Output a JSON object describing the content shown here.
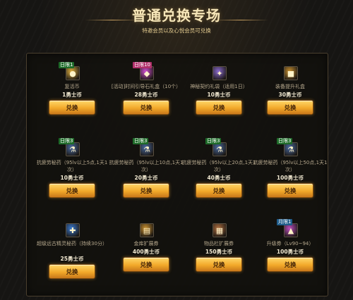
{
  "header": {
    "title": "普通兑换专场",
    "subtitle": "特邀会员以及心悦会员可兑换"
  },
  "items": [
    {
      "limit": "日限1",
      "limit_style": "day",
      "name": "复活币",
      "price": "1勇士币",
      "button": "兑换",
      "icon": "coin-icon",
      "icon_color": "#e0b040"
    },
    {
      "limit": "日限10",
      "limit_style": "pink",
      "name": "[活动]时间引导石礼盒（10个）",
      "price": "28勇士币",
      "button": "兑换",
      "icon": "gem-box-icon",
      "icon_color": "#d050d0"
    },
    {
      "limit": "",
      "limit_style": "",
      "name": "神秘契约礼袋（适用1日）",
      "price": "10勇士币",
      "button": "兑换",
      "icon": "bag-icon",
      "icon_color": "#8a6ad0"
    },
    {
      "limit": "",
      "limit_style": "",
      "name": "装备提升礼盒",
      "price": "30勇士币",
      "button": "兑换",
      "icon": "chest-icon",
      "icon_color": "#c89030"
    },
    {
      "limit": "日限3",
      "limit_style": "day",
      "name": "抗疲劳秘药（95lv以上5点,1天1次）",
      "price": "10勇士币",
      "button": "兑换",
      "icon": "potion-icon",
      "icon_color": "#4a6aa0"
    },
    {
      "limit": "日限3",
      "limit_style": "day",
      "name": "抗疲劳秘药（95lv以上10点,1天1次）",
      "price": "20勇士币",
      "button": "兑换",
      "icon": "potion-icon",
      "icon_color": "#4a6aa0"
    },
    {
      "limit": "日限3",
      "limit_style": "day",
      "name": "抗疲劳秘药（95lv以上20点,1天1次）",
      "price": "40勇士币",
      "button": "兑换",
      "icon": "potion-icon",
      "icon_color": "#4a6aa0"
    },
    {
      "limit": "日限3",
      "limit_style": "day",
      "name": "抗疲劳秘药（95lv以上50点,1天1次）",
      "price": "100勇士币",
      "button": "兑换",
      "icon": "potion-icon",
      "icon_color": "#4a6aa0"
    },
    {
      "limit": "",
      "limit_style": "",
      "name": "超级远古精灵秘药（持续30分）",
      "price": "25勇士币",
      "button": "兑换",
      "icon": "elixir-icon",
      "icon_color": "#3a7ad0"
    },
    {
      "limit": "",
      "limit_style": "",
      "name": "金库扩展券",
      "price": "400勇士币",
      "button": "兑换",
      "icon": "vault-ticket-icon",
      "icon_color": "#c89030"
    },
    {
      "limit": "",
      "limit_style": "",
      "name": "物品栏扩展券",
      "price": "150勇士币",
      "button": "兑换",
      "icon": "inventory-ticket-icon",
      "icon_color": "#b07040"
    },
    {
      "limit": "月限1",
      "limit_style": "month",
      "name": "升级券（Lv90~94）",
      "price": "100勇士币",
      "button": "兑换",
      "icon": "levelup-ticket-icon",
      "icon_color": "#c050c0"
    }
  ]
}
